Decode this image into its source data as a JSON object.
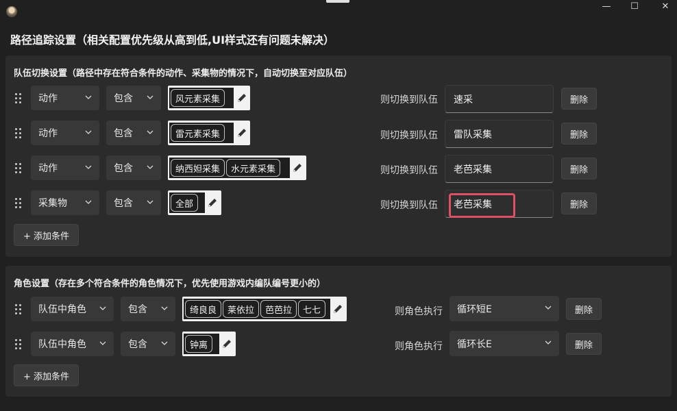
{
  "window": {
    "minimize_glyph": "—",
    "maximize_glyph": "☐",
    "close_glyph": "✕"
  },
  "page_title": "路径追踪设置（相关配置优先级从高到低,UI样式还有问题未解决）",
  "team_section": {
    "title": "队伍切换设置（路径中存在符合条件的动作、采集物的情况下，自动切换至对应队伍）",
    "switch_label": "则切换到队伍",
    "delete_label": "删除",
    "add_label": "+ 添加条件",
    "rows": [
      {
        "type": "动作",
        "op": "包含",
        "chips": [
          "风元素采集"
        ],
        "team": "速采"
      },
      {
        "type": "动作",
        "op": "包含",
        "chips": [
          "雷元素采集"
        ],
        "team": "雷队采集"
      },
      {
        "type": "动作",
        "op": "包含",
        "chips": [
          "纳西妲采集",
          "水元素采集"
        ],
        "team": "老芭采集"
      },
      {
        "type": "采集物",
        "op": "包含",
        "chips": [
          "全部"
        ],
        "team": "老芭采集"
      }
    ]
  },
  "role_section": {
    "title": "角色设置（存在多个符合条件的角色情况下，优先使用游戏内编队编号更小的）",
    "exec_label": "则角色执行",
    "delete_label": "删除",
    "add_label": "+ 添加条件",
    "rows": [
      {
        "type": "队伍中角色",
        "op": "包含",
        "chips": [
          "绮良良",
          "莱依拉",
          "芭芭拉",
          "七七"
        ],
        "action": "循环短E"
      },
      {
        "type": "队伍中角色",
        "op": "包含",
        "chips": [
          "钟离"
        ],
        "action": "循环长E"
      }
    ]
  }
}
